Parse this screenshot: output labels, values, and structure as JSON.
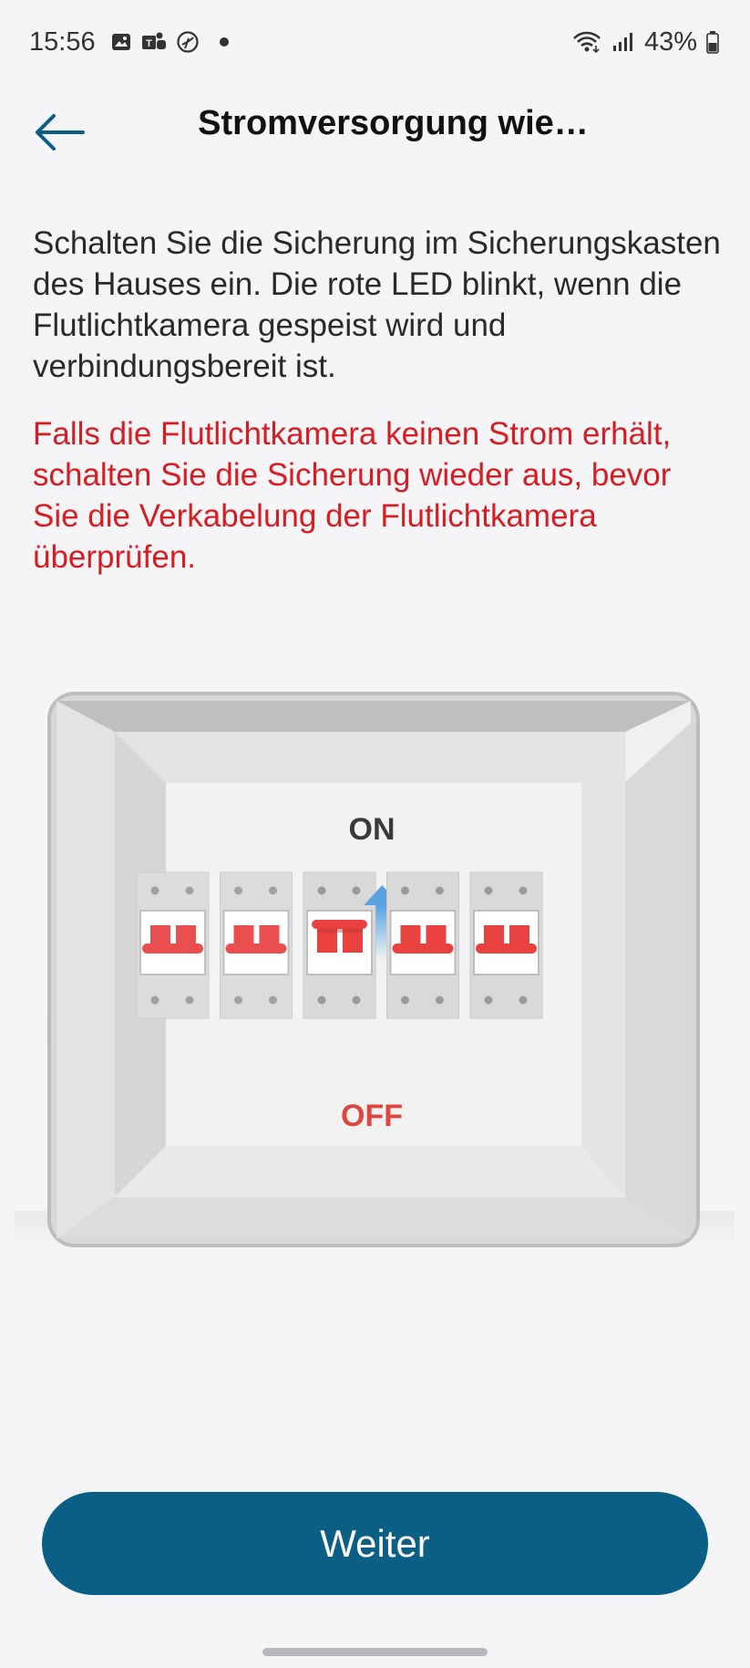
{
  "status_bar": {
    "time": "15:56",
    "battery": "43%",
    "icons": [
      "gallery-icon",
      "teams-icon",
      "browser-icon",
      "notification-dot",
      "wifi-icon",
      "signal-icon",
      "battery-icon"
    ]
  },
  "header": {
    "title": "Stromversorgung wie…",
    "back_icon": "arrow-left-icon"
  },
  "main": {
    "instructions": "Schalten Sie die Sicherung im Sicherungskasten des Hauses ein. Die rote LED blinkt, wenn die Flutlichtkamera gespeist wird und verbindungsbereit ist.",
    "warning": "Falls die Flutlichtkamera keinen Strom erhält, schalten Sie die Sicherung wieder aus, bevor Sie die Verkabelung der Flutlichtkamera überprüfen."
  },
  "illustration": {
    "on_label": "ON",
    "off_label": "OFF",
    "breaker_count": 5,
    "active_breaker": 3,
    "colors": {
      "red": "#e8413f",
      "blue": "#5aa3e0",
      "on": "#3a3a3a",
      "off": "#e0453f"
    }
  },
  "footer": {
    "continue_label": "Weiter",
    "button_color": "#0b5e84"
  }
}
